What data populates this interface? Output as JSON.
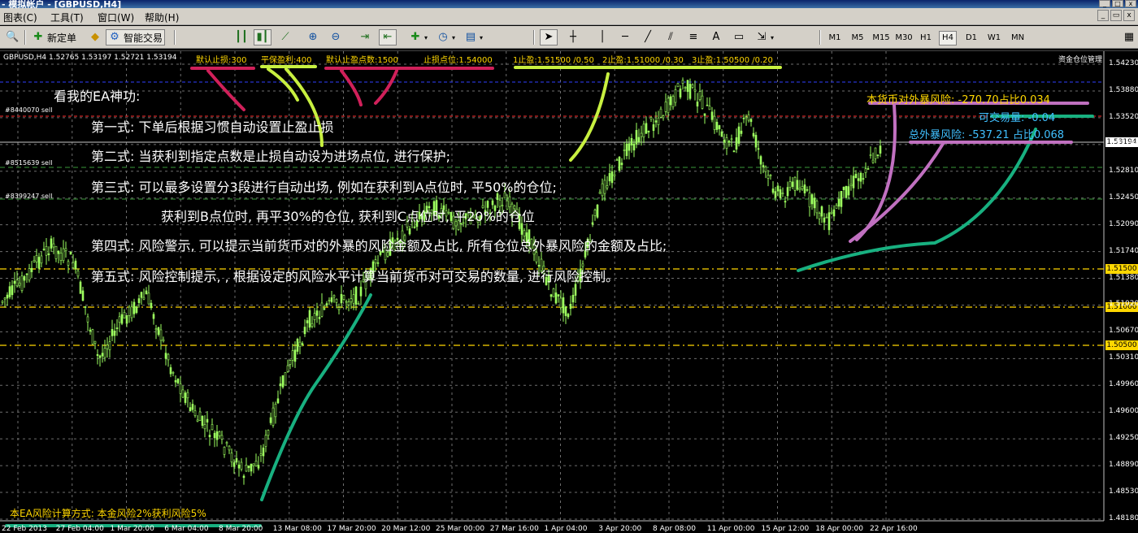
{
  "window": {
    "title": "- 模拟帐户 - [GBPUSD,H4]"
  },
  "menu": [
    {
      "label": "图表(C)"
    },
    {
      "label": "工具(T)"
    },
    {
      "label": "窗口(W)"
    },
    {
      "label": "帮助(H)"
    }
  ],
  "toolbar": {
    "new_order": "新定单",
    "auto_trading": "智能交易",
    "timeframes": [
      "M1",
      "M5",
      "M15",
      "M30",
      "H1",
      "H4",
      "D1",
      "W1",
      "MN"
    ],
    "active_timeframe": "H4"
  },
  "chart": {
    "header": "GBPUSD,H4  1.52765 1.53197 1.52721 1.53194",
    "ea_params": [
      "默认止损:300",
      "平保盈利:400",
      "默认止盈点数:1500",
      "止损点位:1.54000",
      "1止盈:1.51500 /0.50",
      "2止盈:1.51000 /0.30",
      "3止盈:1.50500 /0.20"
    ],
    "manager_label": "资金仓位管理",
    "order_tags": [
      "#8440070 sell",
      "#8515639 sell",
      "#8399247 sell"
    ],
    "annotation": {
      "title": "看我的EA神功:",
      "line1": "第一式: 下单后根据习惯自动设置止盈止损",
      "line2": "第二式: 当获利到指定点数是止损自动设为进场点位, 进行保护;",
      "line3": "第三式: 可以最多设置分3段进行自动出场, 例如在获利到A点位时, 平50%的仓位;",
      "line4": "获利到B点位时, 再平30%的仓位, 获利到C点位时, 平20%的仓位",
      "line5": "第四式: 风险警示, 可以提示当前货币对的外暴的风险金额及占比, 所有仓位总外暴风险的金额及占比;",
      "line6": "第五式: 风险控制提示, , 根据设定的风险水平计算当前货币对可交易的数量, 进行风险控制。"
    },
    "risk": {
      "pair_exposure": "本货币对外暴风险: -270.70占比0.034",
      "tradable": "可交易量: -0.04",
      "total_exposure": "总外暴风险: -537.21 占比0.068"
    },
    "footnote": "本EA风险计算方式: 本金风险2%获利风险5%",
    "current_price": "1.53194",
    "level_labels": [
      "1.51500",
      "1.51000",
      "1.50500"
    ],
    "price_ticks": [
      "1.54230",
      "1.53880",
      "1.53520",
      "1.53194",
      "1.52810",
      "1.52450",
      "1.52090",
      "1.51740",
      "1.51380",
      "1.51020",
      "1.50670",
      "1.50310",
      "1.49960",
      "1.49600",
      "1.49250",
      "1.48890",
      "1.48530",
      "1.48180"
    ],
    "date_ticks": [
      "22 Feb 2013",
      "27 Feb 04:00",
      "1 Mar 20:00",
      "6 Mar 04:00",
      "8 Mar 20:00",
      "13 Mar 08:00",
      "17 Mar 20:00",
      "20 Mar 12:00",
      "25 Mar 00:00",
      "27 Mar 16:00",
      "1 Apr 04:00",
      "3 Apr 20:00",
      "8 Apr 08:00",
      "11 Apr 00:00",
      "15 Apr 12:00",
      "18 Apr 00:00",
      "22 Apr 16:00"
    ],
    "colors": {
      "candle": "#9dff5f",
      "grid": "#6e6e6e",
      "bid_line": "#c8c8c8",
      "stop_line": "#ff3030",
      "tp_lines": "#ffd700",
      "annotation_text": "#ffffff",
      "pink_mark": "#d0205a",
      "lime_mark": "#c8f040",
      "teal_mark": "#18b080",
      "violet_mark": "#c070c0"
    }
  }
}
